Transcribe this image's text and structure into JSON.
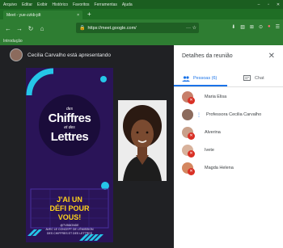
{
  "browser": {
    "menu": [
      "Arquivo",
      "Editar",
      "Exibir",
      "Histórico",
      "Favoritos",
      "Ferramentas",
      "Ajuda"
    ],
    "window_controls": [
      "–",
      "▫",
      "✕"
    ],
    "tab_title": "Meet - yue-zzkb-jdt",
    "tab_close": "×",
    "new_tab": "+",
    "url_text": "https://meet.google.com/",
    "url_end": "··· ☆",
    "bookmark": "Introdução",
    "toolbar_icons": [
      "⬇",
      "▥",
      "⊞",
      "⊙",
      "●",
      "☰"
    ]
  },
  "meet": {
    "presenter_text": "Cecilia Carvalho está apresentando"
  },
  "slide": {
    "des": "des",
    "chiffres": "Chiffres",
    "et": "et des",
    "lettres": "Lettres",
    "line1": "J'AI UN",
    "line2": "DÉFI POUR",
    "line3": "VOUS!",
    "small_text": "@TV5MONDE\nAVEC LE CONCEPT DE L'ÉMISSION\nDES CHIFFRES ET DES LETTRES"
  },
  "panel": {
    "title": "Detalhes da reunião",
    "close": "✕",
    "tab_people": "Pessoas (6)",
    "tab_chat": "Chat",
    "people": [
      {
        "name": "Maria Elisa",
        "color": "#c77f6a"
      },
      {
        "name": "Professora Cecilia Carvalho",
        "color": "#8c6b5d"
      },
      {
        "name": "Alverina",
        "color": "#c9a08a"
      },
      {
        "name": "Ivete",
        "color": "#d8b29c"
      },
      {
        "name": "Magda Helena",
        "color": "#d48760"
      }
    ]
  },
  "colors": {
    "browser_green": "#2e7d32",
    "meet_bg": "#202124",
    "accent_blue": "#1a73e8",
    "mute_red": "#d93025",
    "slide_purple": "#2a1458",
    "slide_cyan": "#25c6e8",
    "slide_yellow": "#ffd21a"
  }
}
